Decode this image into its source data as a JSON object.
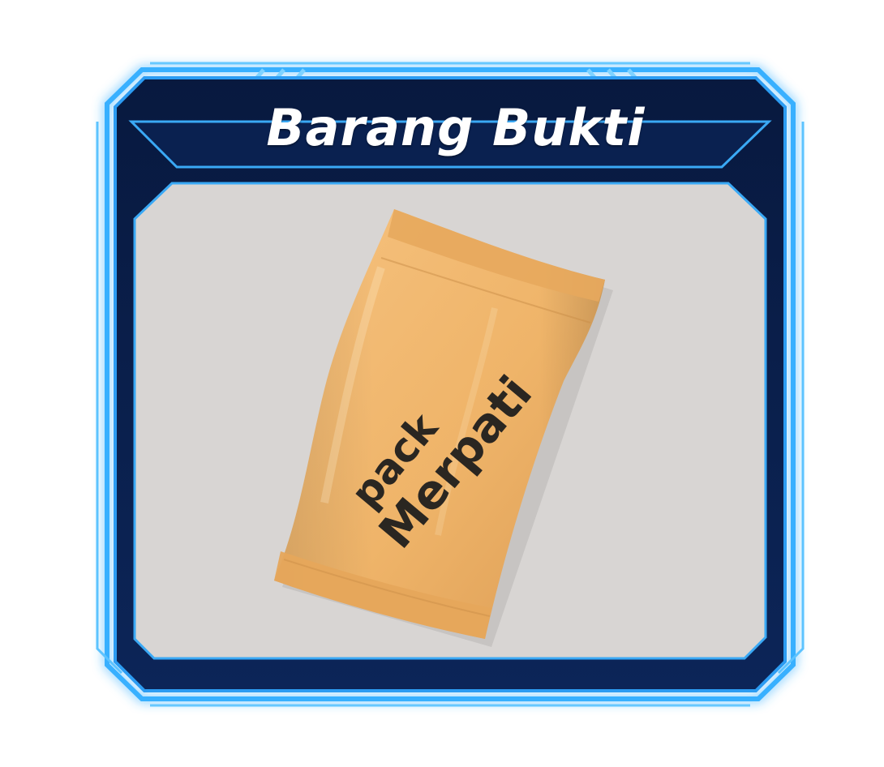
{
  "panel": {
    "title": "Barang Bukti"
  },
  "evidence": {
    "label_line1": "pack",
    "label_line2": "Merpati",
    "item_icon": "sachet-packet-icon"
  },
  "colors": {
    "frame_dark": "#0a1f4a",
    "frame_glow": "#2ea6ff",
    "content_bg": "#d8d5d3",
    "packet": "#f0b46a",
    "label_text": "#2a2621",
    "title_text": "#ffffff"
  }
}
